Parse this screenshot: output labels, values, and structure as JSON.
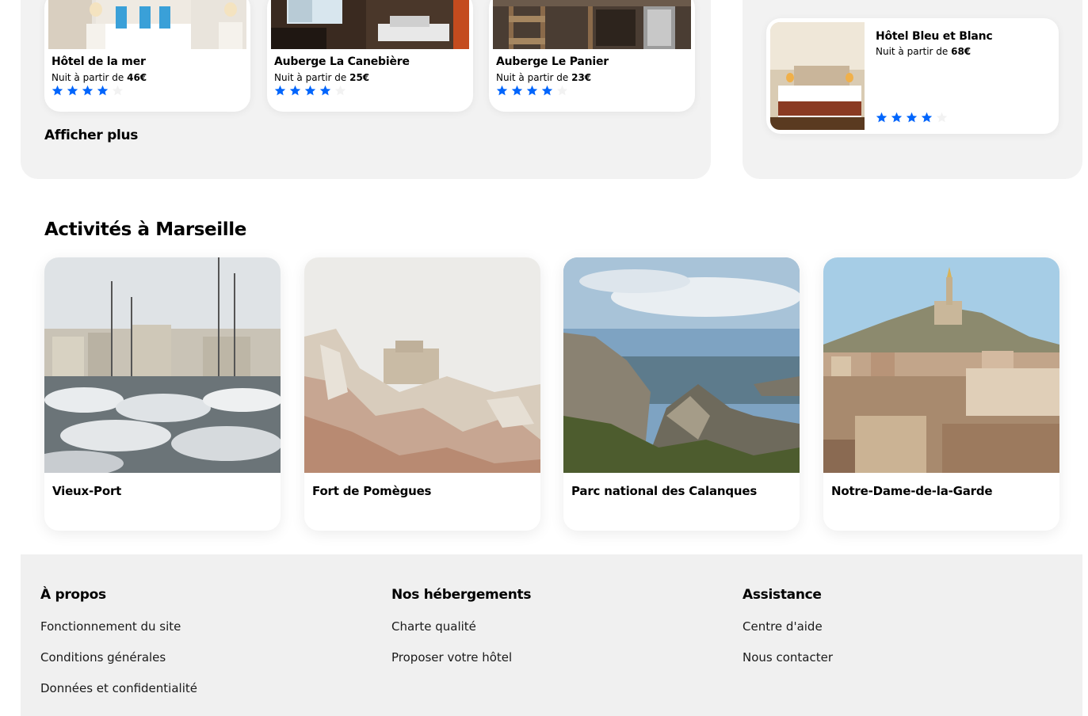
{
  "hotels_section": {
    "cards": [
      {
        "name": "Hôtel de la mer",
        "price_prefix": "Nuit à partir de ",
        "price": "46€",
        "rating": 4,
        "max_rating": 5
      },
      {
        "name": "Auberge La Canebière",
        "price_prefix": "Nuit à partir de ",
        "price": "25€",
        "rating": 4,
        "max_rating": 5
      },
      {
        "name": "Auberge Le Panier",
        "price_prefix": "Nuit à partir de ",
        "price": "23€",
        "rating": 4,
        "max_rating": 5
      }
    ],
    "show_more_label": "Afficher plus"
  },
  "side_panel": {
    "card": {
      "name": "Hôtel Bleu et Blanc",
      "price_prefix": "Nuit à partir de ",
      "price": "68€",
      "rating": 4,
      "max_rating": 5
    }
  },
  "activities": {
    "title": "Activités à Marseille",
    "items": [
      {
        "label": "Vieux-Port",
        "icon": "photo-harbor-boats"
      },
      {
        "label": "Fort de Pomègues",
        "icon": "photo-rocky-fort"
      },
      {
        "label": "Parc national des Calanques",
        "icon": "photo-cliffs-sea"
      },
      {
        "label": "Notre-Dame-de-la-Garde",
        "icon": "photo-city-hill-basilica"
      }
    ]
  },
  "footer": {
    "columns": [
      {
        "title": "À propos",
        "links": [
          "Fonctionnement du site",
          "Conditions générales",
          "Données et confidentialité"
        ]
      },
      {
        "title": "Nos hébergements",
        "links": [
          "Charte qualité",
          "Proposer votre hôtel"
        ]
      },
      {
        "title": "Assistance",
        "links": [
          "Centre d'aide",
          "Nous contacter"
        ]
      }
    ]
  },
  "colors": {
    "star_active": "#0065fc",
    "star_inactive": "#f2f2f2",
    "panel_bg": "#f2f2f2",
    "footer_bg": "#f0f0f0"
  }
}
